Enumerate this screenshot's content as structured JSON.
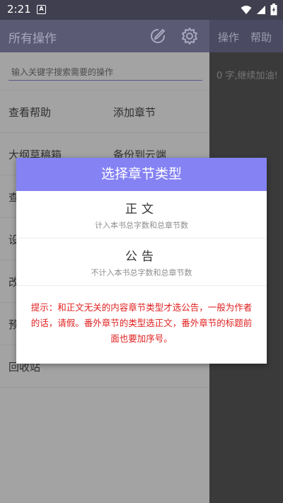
{
  "status_bar": {
    "time": "2:21",
    "notification_letter": "A"
  },
  "background_app": {
    "actions": [
      "操作",
      "帮助"
    ],
    "message": "0 字,继续加油!"
  },
  "drawer": {
    "title": "所有操作",
    "search_placeholder": "输入关键字搜索需要的操作",
    "menu": [
      {
        "left": "查看帮助",
        "right": "添加章节"
      },
      {
        "left": "大纲草稿箱",
        "right": "备份到云端"
      },
      {
        "left": "查",
        "right": ""
      },
      {
        "left": "设",
        "right": ""
      },
      {
        "left": "改",
        "right": ""
      },
      {
        "left": "预",
        "right": ""
      },
      {
        "left": "回收站",
        "right": ""
      }
    ]
  },
  "dialog": {
    "title": "选择章节类型",
    "options": [
      {
        "title": "正文",
        "subtitle": "计入本书总字数和总章节数"
      },
      {
        "title": "公告",
        "subtitle": "不计入本书总字数和总章节数"
      }
    ],
    "tip": "提示：和正文无关的内容章节类型才选公告，一般为作者的话，请假。番外章节的类型选正文，番外章节的标题前面也要加序号。"
  },
  "colors": {
    "dialog_header": "#8582f4",
    "tip_text": "#e02020",
    "drawer_header": "#5b5a74",
    "status_bar": "#3f3f4f"
  }
}
